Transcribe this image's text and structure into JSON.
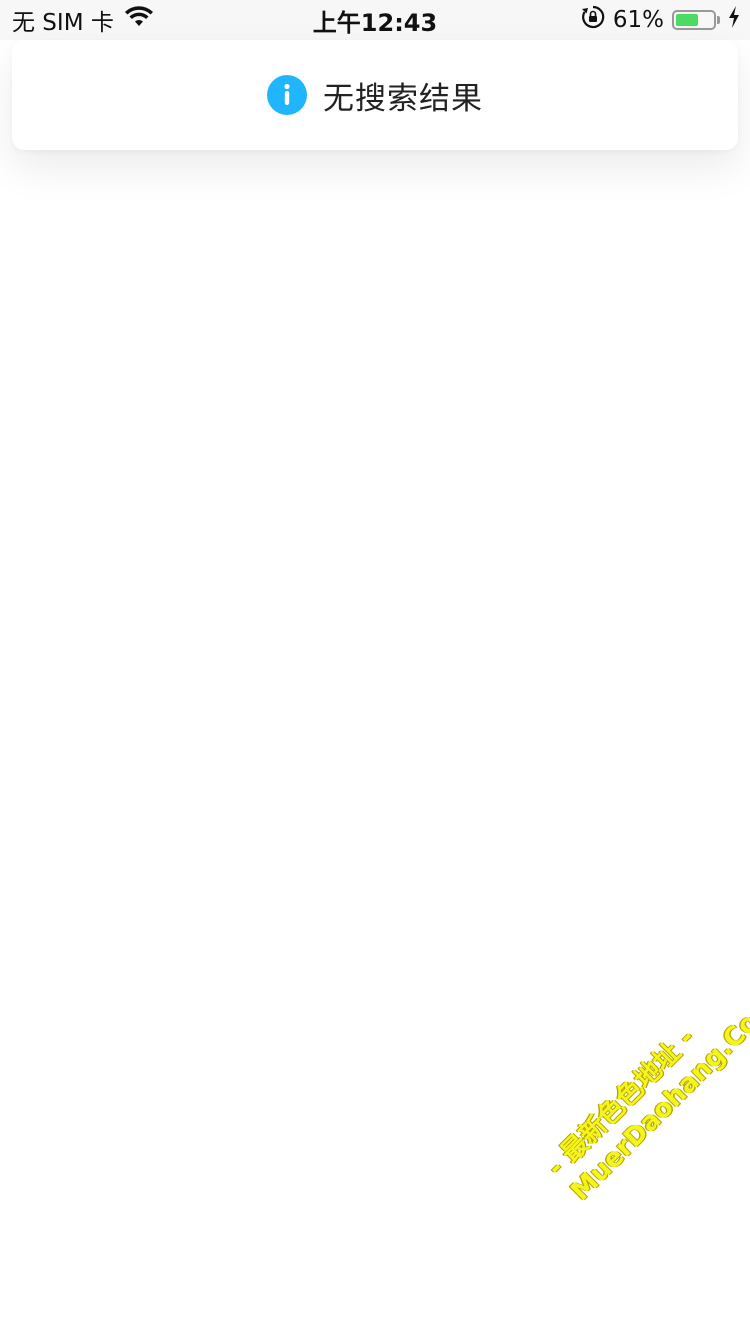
{
  "status_bar": {
    "carrier": "无 SIM 卡",
    "time": "上午12:43",
    "battery_percent": "61%",
    "battery_level": 0.61,
    "icons": [
      "wifi-icon",
      "orientation-lock-icon",
      "battery-icon",
      "charging-bolt-icon"
    ]
  },
  "toast": {
    "icon": "info-icon",
    "message": "无搜索结果",
    "icon_color": "#1fb6ff"
  },
  "watermark": {
    "line1": "- 最新色色地址 -",
    "line2": "MuerDaohang.Com",
    "color": "#f4f51a"
  }
}
